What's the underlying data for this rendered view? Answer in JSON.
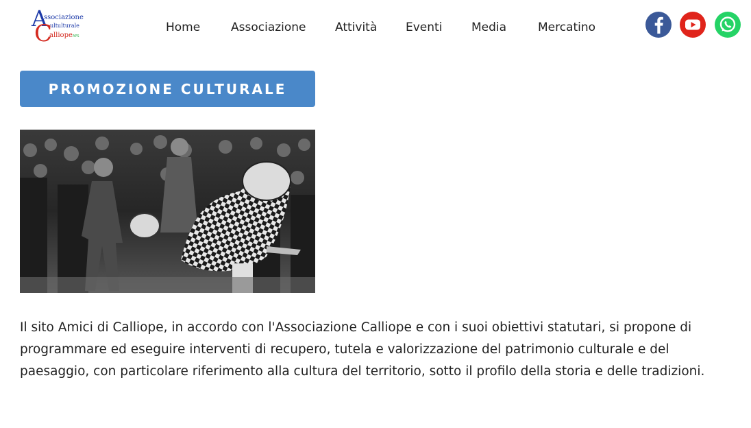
{
  "header": {
    "logo": {
      "line1": "Associazione",
      "line2": "Multiculturale",
      "line3": "Calliope",
      "suffix": "APS",
      "colors": {
        "red": "#d42a20",
        "blue": "#1d3aa8",
        "green": "#2fb34a"
      }
    },
    "nav": [
      "Home",
      "Associazione",
      "Attività",
      "Eventi",
      "Media",
      "Mercatino"
    ],
    "social": [
      {
        "name": "facebook-icon",
        "color": "#3b5998"
      },
      {
        "name": "youtube-icon",
        "color": "#e0241b"
      },
      {
        "name": "whatsapp-icon",
        "color": "#25d366"
      }
    ]
  },
  "main": {
    "section_button": "PROMOZIONE CULTURALE",
    "button_color": "#4a88c9",
    "photo": "black-and-white photograph of a festival dancer in a checkered costume with a crowd and a drummer",
    "paragraph": "Il sito Amici di Calliope, in accordo con l'Associazione Calliope e con i suoi obiettivi statutari, si propone di programmare ed eseguire interventi di recupero, tutela e valorizzazione del patrimonio culturale e del paesaggio, con particolare riferimento alla cultura del territorio, sotto il profilo della storia e delle tradizioni."
  }
}
